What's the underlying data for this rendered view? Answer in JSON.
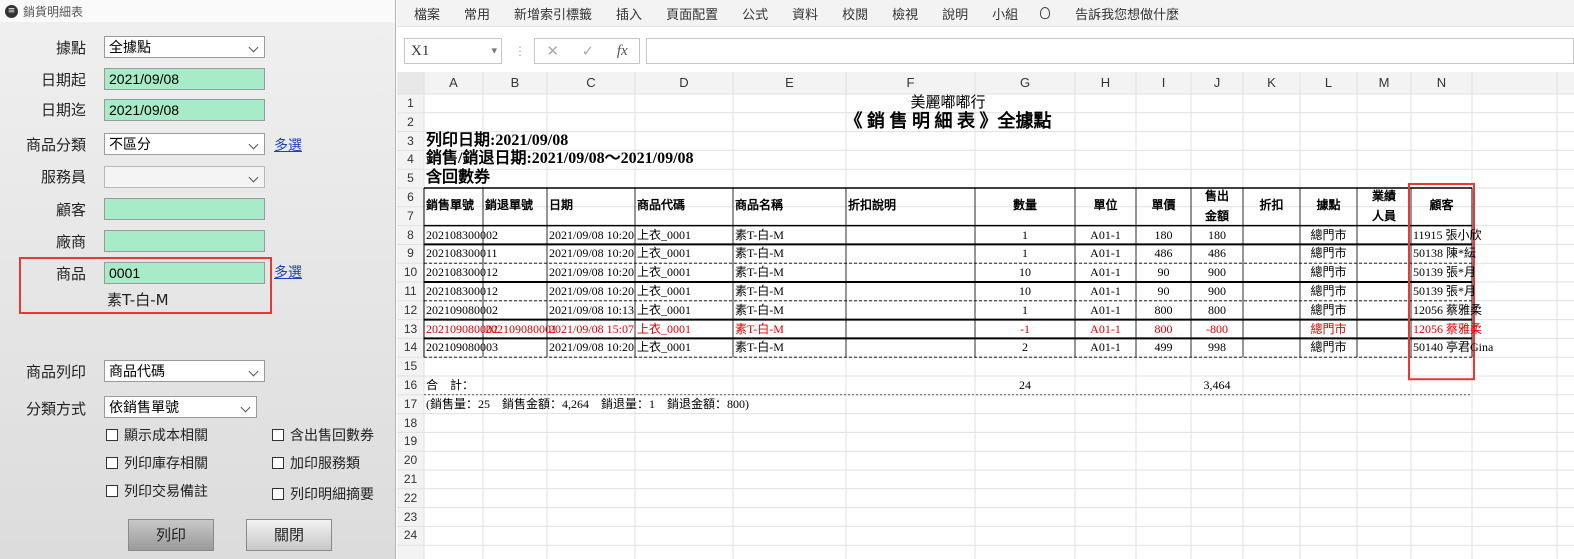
{
  "dialog": {
    "title": "銷貨明細表",
    "fields": {
      "store": {
        "label": "據點",
        "value": "全據點"
      },
      "date_from": {
        "label": "日期起",
        "value": "2021/09/08"
      },
      "date_to": {
        "label": "日期迄",
        "value": "2021/09/08"
      },
      "category": {
        "label": "商品分類",
        "value": "不區分"
      },
      "staff": {
        "label": "服務員",
        "value": ""
      },
      "customer": {
        "label": "顧客",
        "value": ""
      },
      "vendor": {
        "label": "廠商",
        "value": ""
      },
      "product": {
        "label": "商品",
        "value": "0001",
        "name": "素T-白-M"
      },
      "print_product": {
        "label": "商品列印",
        "value": "商品代碼"
      },
      "sort_by": {
        "label": "分類方式",
        "value": "依銷售單號"
      }
    },
    "multi_select_link": "多選",
    "checkboxes": [
      "顯示成本相關",
      "含出售回數券",
      "列印庫存相關",
      "加印服務類",
      "列印交易備註",
      "列印明細摘要"
    ],
    "buttons": {
      "print": "列印",
      "close": "關閉"
    }
  },
  "excel": {
    "tabs": [
      "檔案",
      "常用",
      "新增索引標籤",
      "插入",
      "頁面配置",
      "公式",
      "資料",
      "校閱",
      "檢視",
      "說明",
      "小組"
    ],
    "tell_me": "告訴我您想做什麼",
    "name_box": "X1",
    "formula_icons": [
      "✕",
      "✓",
      "fx"
    ],
    "columns": [
      "A",
      "B",
      "C",
      "D",
      "E",
      "F",
      "G",
      "H",
      "I",
      "J",
      "K",
      "L",
      "M",
      "N"
    ],
    "row_numbers": [
      "1",
      "2",
      "3",
      "4",
      "5",
      "6",
      "7",
      "8",
      "9",
      "10",
      "11",
      "12",
      "13",
      "14",
      "15",
      "16",
      "17",
      "18",
      "19",
      "20",
      "21",
      "22",
      "23",
      "24"
    ],
    "report": {
      "company": "美麗嘟嘟行",
      "title": "《 銷 售 明 細 表 》全據點",
      "print_date": "列印日期:2021/09/08",
      "range": "銷售/銷退日期:2021/09/08～2021/09/08",
      "note": "含回數券",
      "headers": {
        "sale_no": "銷售單號",
        "return_no": "銷退單號",
        "date": "日期",
        "code": "商品代碼",
        "name": "商品名稱",
        "discount_note": "折扣說明",
        "qty": "數量",
        "unit": "單位",
        "price": "單價",
        "amount_1": "售出",
        "amount_2": "金額",
        "discount": "折扣",
        "store": "據點",
        "sales_1": "業績",
        "sales_2": "人員",
        "customer": "顧客"
      },
      "rows": [
        {
          "sale_no": "202108300002",
          "return_no": "",
          "date": "2021/09/08 10:20",
          "code": "上衣_0001",
          "name": "素T-白-M",
          "qty": "1",
          "unit": "A01-1",
          "price": "180",
          "amount": "180",
          "store": "總門市",
          "customer": "11915 張小欣",
          "red": false
        },
        {
          "sale_no": "202108300011",
          "return_no": "",
          "date": "2021/09/08 10:20",
          "code": "上衣_0001",
          "name": "素T-白-M",
          "qty": "1",
          "unit": "A01-1",
          "price": "486",
          "amount": "486",
          "store": "總門市",
          "customer": "50138 陳*紜",
          "red": false
        },
        {
          "sale_no": "202108300012",
          "return_no": "",
          "date": "2021/09/08 10:20",
          "code": "上衣_0001",
          "name": "素T-白-M",
          "qty": "10",
          "unit": "A01-1",
          "price": "90",
          "amount": "900",
          "store": "總門市",
          "customer": "50139 張*月",
          "red": false
        },
        {
          "sale_no": "202108300012",
          "return_no": "",
          "date": "2021/09/08 10:20",
          "code": "上衣_0001",
          "name": "素T-白-M",
          "qty": "10",
          "unit": "A01-1",
          "price": "90",
          "amount": "900",
          "store": "總門市",
          "customer": "50139 張*月",
          "red": false
        },
        {
          "sale_no": "202109080002",
          "return_no": "",
          "date": "2021/09/08 10:13",
          "code": "上衣_0001",
          "name": "素T-白-M",
          "qty": "1",
          "unit": "A01-1",
          "price": "800",
          "amount": "800",
          "store": "總門市",
          "customer": "12056 蔡雅柔",
          "red": false
        },
        {
          "sale_no": "202109080002",
          "return_no": "202109080001",
          "date": "2021/09/08 15:07",
          "code": "上衣_0001",
          "name": "素T-白-M",
          "qty": "-1",
          "unit": "A01-1",
          "price": "800",
          "amount": "-800",
          "store": "總門市",
          "customer": "12056 蔡雅柔",
          "red": true
        },
        {
          "sale_no": "202109080003",
          "return_no": "",
          "date": "2021/09/08 10:20",
          "code": "上衣_0001",
          "name": "素T-白-M",
          "qty": "2",
          "unit": "A01-1",
          "price": "499",
          "amount": "998",
          "store": "總門市",
          "customer": "50140 亭君Gina",
          "red": false
        }
      ],
      "total_label": "合　計：",
      "total_qty": "24",
      "total_amount": "3,464",
      "summary": "(銷售量：25　銷售金額：4,264　銷退量：1　銷退金額：800)"
    }
  }
}
